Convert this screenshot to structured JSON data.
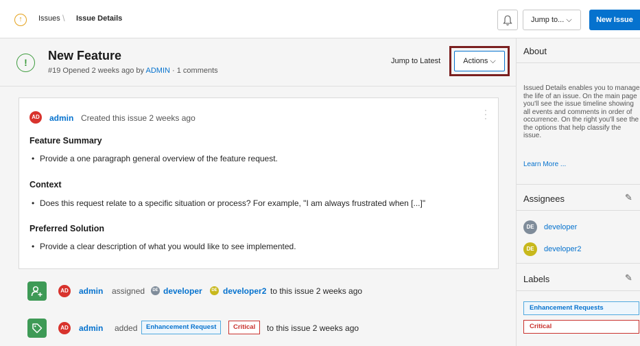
{
  "breadcrumb": {
    "item1": "Issues",
    "separator": "\\",
    "item2": "Issue Details"
  },
  "toolbar": {
    "jump_to": "Jump to... ⌵",
    "new_issue": "New Issue",
    "bell_icon": "bell-icon"
  },
  "issue": {
    "title": "New Feature",
    "subtitle_prefix": "#19 Opened 2 weeks ago by",
    "author": "ADMIN",
    "subtitle_suffix": "· 1 comments",
    "jump_latest": "Jump to Latest",
    "actions": "Actions ⌵"
  },
  "comment": {
    "avatar": "AD",
    "user": "admin",
    "meta": "Created this issue 2 weeks ago",
    "sections": [
      {
        "heading": "Feature Summary",
        "item": "Provide a one paragraph general overview of the feature request."
      },
      {
        "heading": "Context",
        "item": "Does this request relate to a specific situation or process? For example, \"I am always frustrated when [...]\""
      },
      {
        "heading": "Preferred Solution",
        "item": "Provide a clear description of what you would like to see implemented."
      }
    ]
  },
  "activity": [
    {
      "avatar": "AD",
      "user": "admin",
      "verb": "assigned",
      "target1_avatar": "DE",
      "target1": "developer",
      "target2_avatar": "DE",
      "target2": "developer2",
      "tail": "to this issue 2 weeks ago"
    },
    {
      "avatar": "AD",
      "user": "admin",
      "verb": "added",
      "tag1": "Enhancement Request",
      "tag2": "Critical",
      "tail": "to this issue 2 weeks ago"
    }
  ],
  "sidebar": {
    "about_title": "About",
    "about_text": "Issued Details enables you to manage the life of an issue. On the main page you'll see the issue timeline showing all events and comments in order of occurrence. On the right you'll see the the options that help classify the issue.",
    "learn_more": "Learn More ...",
    "assignees_title": "Assignees",
    "assignees": [
      {
        "avatar": "DE",
        "name": "developer",
        "color": "#7f8c9a"
      },
      {
        "avatar": "DE",
        "name": "developer2",
        "color": "#c8b81c"
      }
    ],
    "labels_title": "Labels",
    "labels": [
      "Enhancement Requests",
      "Critical"
    ]
  },
  "colors": {
    "accent": "#0572ce",
    "success": "#3e9a56",
    "danger": "#c9302c",
    "highlight": "#7a1f1f"
  }
}
